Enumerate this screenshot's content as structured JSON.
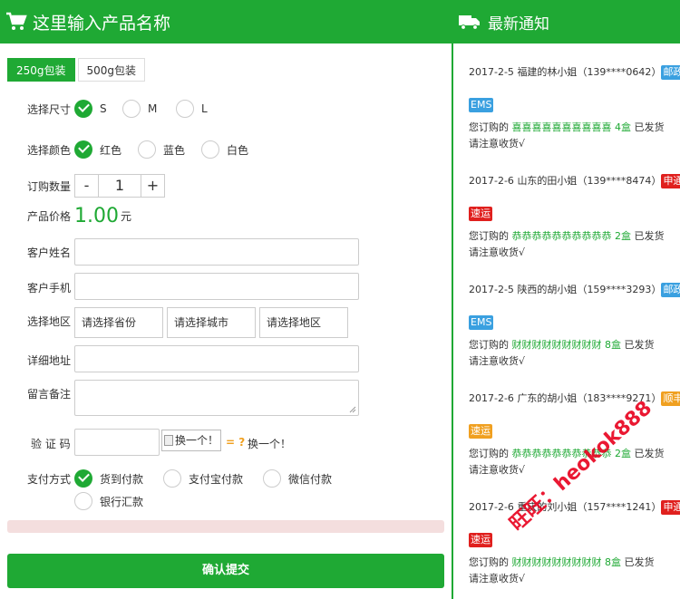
{
  "left": {
    "title": "这里输入产品名称",
    "packages": [
      "250g包装",
      "500g包装"
    ],
    "size": {
      "label": "选择尺寸",
      "options": [
        "S",
        "M",
        "L"
      ],
      "selected": 0
    },
    "color": {
      "label": "选择颜色",
      "options": [
        "红色",
        "蓝色",
        "白色"
      ],
      "selected": 0
    },
    "quantity": {
      "label": "订购数量",
      "minus": "-",
      "value": "1",
      "plus": "+"
    },
    "price": {
      "label": "产品价格",
      "value": "1.00",
      "unit": "元"
    },
    "name_label": "客户姓名",
    "phone_label": "客户手机",
    "region": {
      "label": "选择地区",
      "province": "请选择省份",
      "city": "请选择城市",
      "district": "请选择地区"
    },
    "address_label": "详细地址",
    "remark_label": "留言备注",
    "captcha": {
      "label": "验 证 码",
      "img_alt": "换一个！",
      "eq": "= ?",
      "refresh": "换一个！"
    },
    "payment": {
      "label": "支付方式",
      "options": [
        "货到付款",
        "支付宝付款",
        "微信付款",
        "银行汇款"
      ],
      "selected": 0
    },
    "submit": "确认提交"
  },
  "right": {
    "title": "最新通知",
    "notices": [
      {
        "date": "2017-2-5",
        "who": "福建的林小姐",
        "phone": "139****0642",
        "b1": "邮政",
        "b1_color": "#3aa0e0",
        "b2": "EMS",
        "b2_color": "#3aa0e0",
        "prefix": "您订购的",
        "product": "喜喜喜喜喜喜喜喜喜喜",
        "qty": "4盒",
        "suffix1": "已发货",
        "suffix2": "请注意收货√"
      },
      {
        "date": "2017-2-6",
        "who": "山东的田小姐",
        "phone": "139****8474",
        "b1": "申通",
        "b1_color": "#e0201e",
        "b2": "速运",
        "b2_color": "#e0201e",
        "prefix": "您订购的",
        "product": "恭恭恭恭恭恭恭恭恭恭",
        "qty": "2盒",
        "suffix1": "已发货",
        "suffix2": "请注意收货√"
      },
      {
        "date": "2017-2-5",
        "who": "陕西的胡小姐",
        "phone": "159****3293",
        "b1": "邮政",
        "b1_color": "#3aa0e0",
        "b2": "EMS",
        "b2_color": "#3aa0e0",
        "prefix": "您订购的",
        "product": "财财财财财财财财财",
        "qty": "8盒",
        "suffix1": "已发货",
        "suffix2": "请注意收货√"
      },
      {
        "date": "2017-2-6",
        "who": "广东的胡小姐",
        "phone": "183****9271",
        "b1": "顺丰",
        "b1_color": "#f0a020",
        "b2": "速运",
        "b2_color": "#f0a020",
        "prefix": "您订购的",
        "product": "恭恭恭恭恭恭恭恭恭恭",
        "qty": "2盒",
        "suffix1": "已发货",
        "suffix2": "请注意收货√"
      },
      {
        "date": "2017-2-6",
        "who": "重庆的刘小姐",
        "phone": "157****1241",
        "b1": "申通",
        "b1_color": "#e0201e",
        "b2": "速运",
        "b2_color": "#e0201e",
        "prefix": "您订购的",
        "product": "财财财财财财财财财",
        "qty": "8盒",
        "suffix1": "已发货",
        "suffix2": "请注意收货√"
      }
    ]
  },
  "watermark": "旺旺：heokok888",
  "colors": {
    "brand": "#1fa934",
    "pink_bar": "#f4dede"
  }
}
